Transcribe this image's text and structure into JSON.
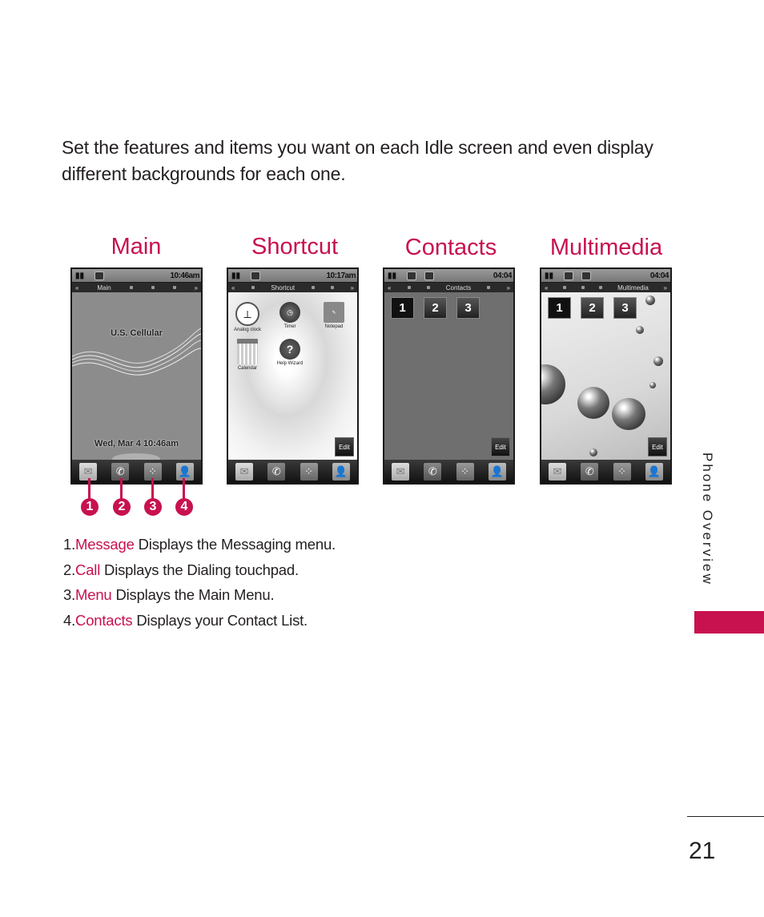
{
  "intro_text": "Set the features and items you want on each Idle screen and even display different backgrounds for each one.",
  "screens": [
    {
      "title": "Main",
      "status": {
        "time": "10:46am"
      },
      "nav_label": "Main",
      "carrier": "U.S. Cellular",
      "datetime": "Wed, Mar 4   10:46am"
    },
    {
      "title": "Shortcut",
      "status": {
        "time": "10:17am"
      },
      "nav_label": "Shortcut",
      "shortcuts": [
        "Analog clock",
        "Timer",
        "Notepad",
        "Calendar",
        "Help Wizard"
      ],
      "edit_label": "Edit"
    },
    {
      "title": "Contacts",
      "status": {
        "time": "04:04"
      },
      "nav_label": "Contacts",
      "tabs": [
        "1",
        "2",
        "3"
      ],
      "edit_label": "Edit"
    },
    {
      "title": "Multimedia",
      "status": {
        "time": "04:04"
      },
      "nav_label": "Multimedia",
      "tabs": [
        "1",
        "2",
        "3"
      ],
      "edit_label": "Edit"
    }
  ],
  "dock_icons": [
    "message-icon",
    "call-icon",
    "menu-icon",
    "contacts-icon"
  ],
  "callouts": [
    "1",
    "2",
    "3",
    "4"
  ],
  "legend": [
    {
      "num": "1.",
      "key": "Message",
      "desc": " Displays the Messaging menu."
    },
    {
      "num": "2.",
      "key": "Call",
      "desc": " Displays the Dialing touchpad."
    },
    {
      "num": "3.",
      "key": "Menu",
      "desc": " Displays the Main Menu."
    },
    {
      "num": "4.",
      "key": "Contacts",
      "desc": " Displays your Contact List."
    }
  ],
  "side_label": "Phone Overview",
  "page_number": "21",
  "colors": {
    "accent": "#c8114f",
    "text": "#231f20"
  }
}
